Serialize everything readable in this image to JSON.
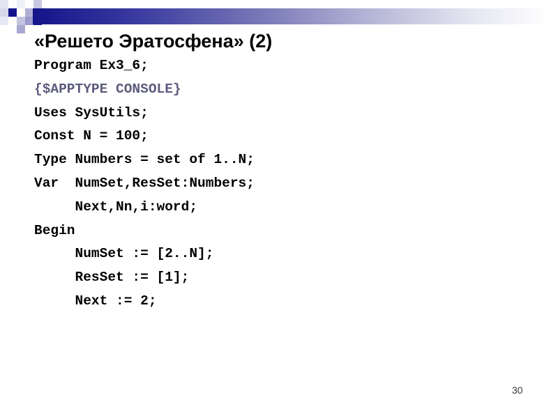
{
  "slide": {
    "title": "«Решето Эратосфена» (2)",
    "accent_colors": {
      "header_bar_start": "#14148a",
      "header_bar_end": "#ffffff",
      "directive_text": "#5b5b7e"
    },
    "code_lines": [
      {
        "text": "Program Ex3_6;",
        "kind": "code"
      },
      {
        "text": "{$APPTYPE CONSOLE}",
        "kind": "directive"
      },
      {
        "text": "Uses SysUtils;",
        "kind": "code"
      },
      {
        "text": "Const N = 100;",
        "kind": "code"
      },
      {
        "text": "Type Numbers = set of 1..N;",
        "kind": "code"
      },
      {
        "text": "Var  NumSet,ResSet:Numbers;",
        "kind": "code"
      },
      {
        "text": "     Next,Nn,i:word;",
        "kind": "code"
      },
      {
        "text": "Begin",
        "kind": "code"
      },
      {
        "text": "     NumSet := [2..N];",
        "kind": "code"
      },
      {
        "text": "     ResSet := [1];",
        "kind": "code"
      },
      {
        "text": "     Next := 2;",
        "kind": "code"
      }
    ],
    "page_number": "30"
  }
}
